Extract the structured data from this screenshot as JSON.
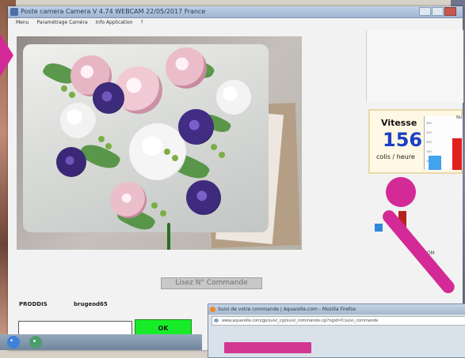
{
  "window": {
    "title": "Poste camera Camera V 4.74 WEBCAM 22/05/2017 France",
    "menu": [
      "Menu",
      "Paramétrage Caméra",
      "Info Application",
      "?"
    ]
  },
  "speed": {
    "label": "Vitesse",
    "value": "156",
    "unit": "colis / heure"
  },
  "zoom_label": "ZOOM",
  "command_button": "Lisez N° Commande",
  "bottom_left": {
    "label": "PRODDIS",
    "value": "brugeod65"
  },
  "ok_button": "OK",
  "browser": {
    "title": "Suivi de votre commande | Aquarelle.com - Mozilla Firefox",
    "address": "www.aquarelle.com/gp/suivi_cgi/suivi_commande.cgi?ngid=0;suivi_commande"
  }
}
